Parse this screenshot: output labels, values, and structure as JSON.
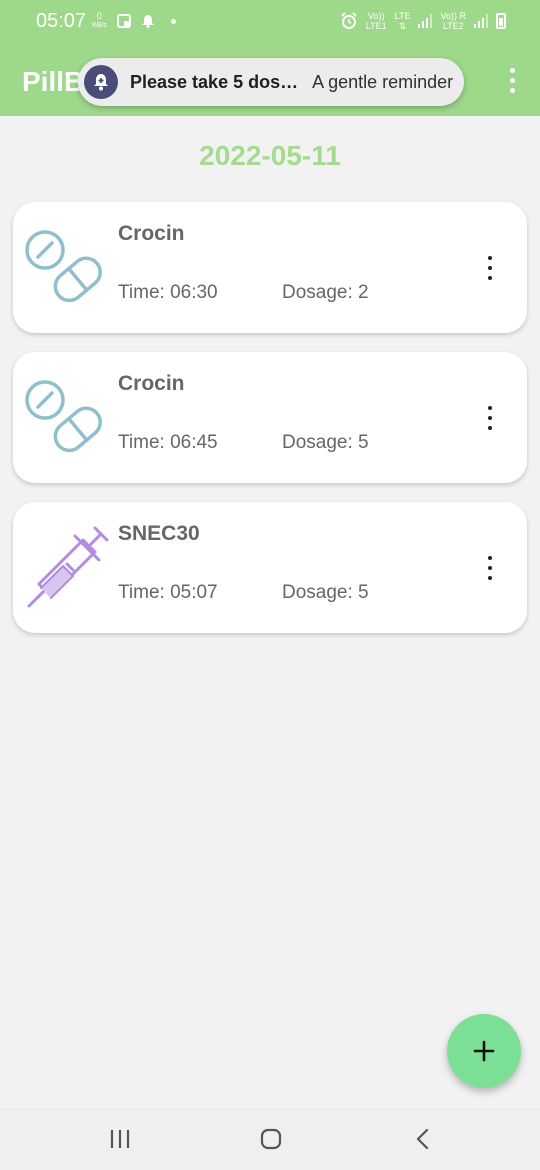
{
  "status_bar": {
    "time": "05:07",
    "data_speed": "0",
    "data_speed_unit": "KB/s",
    "sim1_top": "Vo))",
    "sim1_bottom": "LTE1",
    "lte_label": "LTE",
    "sim2_top": "Vo))",
    "sim2_bottom": "LTE2",
    "sim2_r": "R"
  },
  "app_bar": {
    "title": "PillB"
  },
  "notification": {
    "title": "Please take 5 dos…",
    "subtitle": "A gentle reminder"
  },
  "date": "2022-05-11",
  "medications": [
    {
      "name": "Crocin",
      "time": "Time: 06:30",
      "dosage": "Dosage: 2",
      "icon": "pill-icon"
    },
    {
      "name": "Crocin",
      "time": "Time: 06:45",
      "dosage": "Dosage: 5",
      "icon": "pill-icon"
    },
    {
      "name": "SNEC30",
      "time": "Time: 05:07",
      "dosage": "Dosage: 5",
      "icon": "syringe-icon"
    }
  ],
  "colors": {
    "app_bar": "#9ed88a",
    "date_text": "#a5db90",
    "fab": "#7cdf96",
    "pill_icon": "#8fbfcc",
    "syringe_icon": "#b48be0"
  }
}
